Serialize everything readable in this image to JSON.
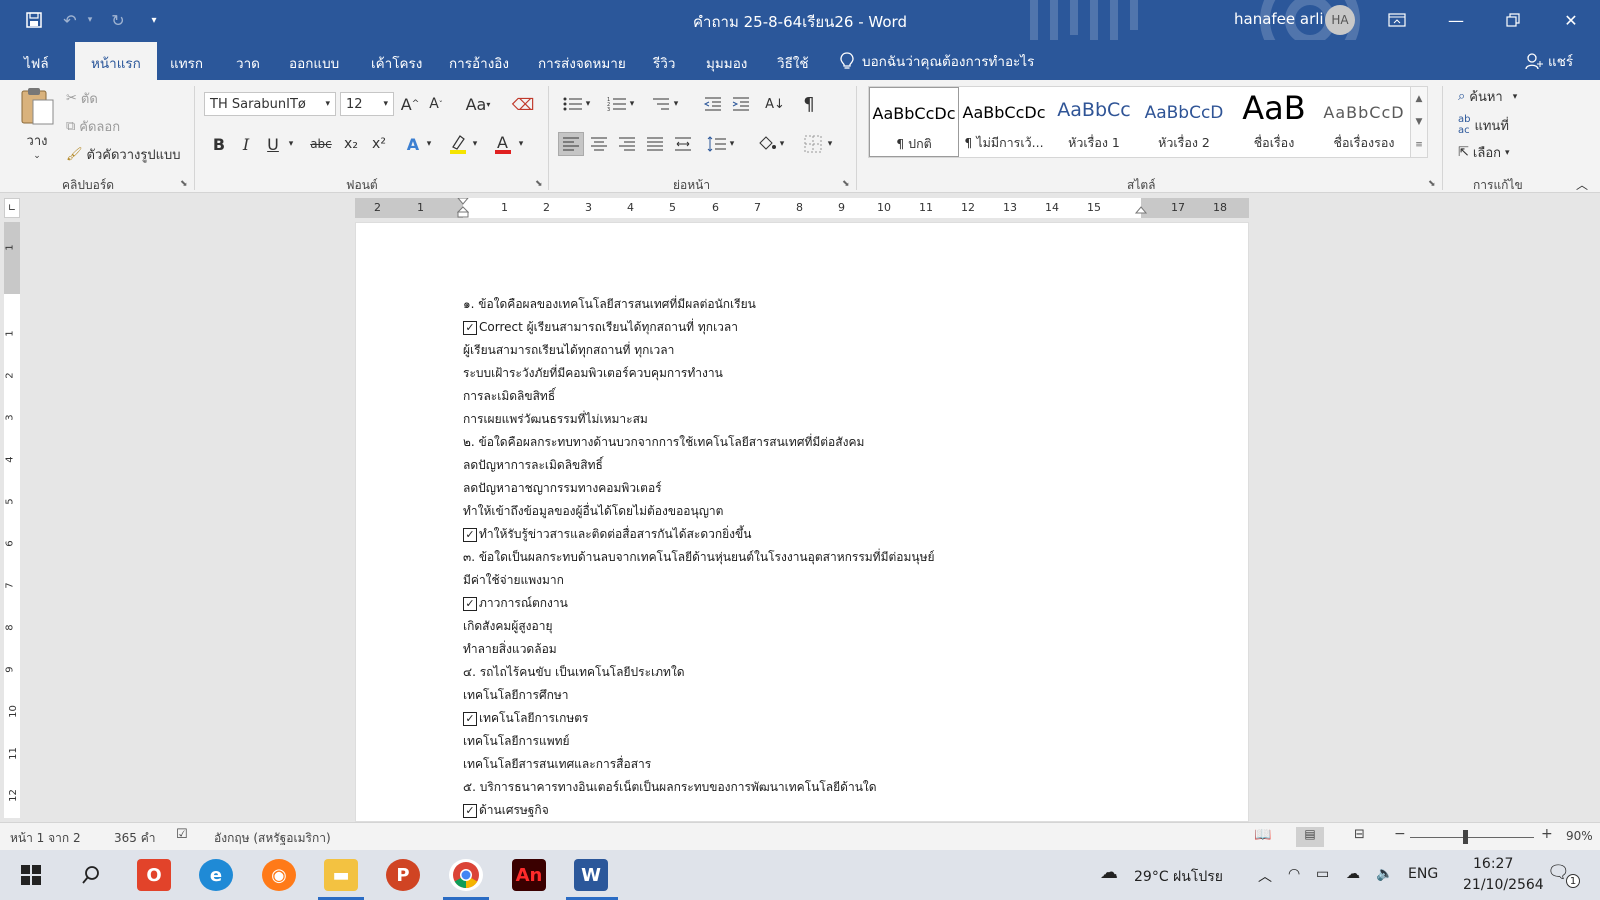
{
  "window": {
    "title": "คำถาม 25-8-64เรียน26  -  Word",
    "user_name": "hanafee arli",
    "user_initials": "HA"
  },
  "tabs": [
    "ไฟล์",
    "หน้าแรก",
    "แทรก",
    "วาด",
    "ออกแบบ",
    "เค้าโครง",
    "การอ้างอิง",
    "การส่งจดหมาย",
    "รีวิว",
    "มุมมอง",
    "วิธีใช้"
  ],
  "tell_me": "บอกฉันว่าคุณต้องการทำอะไร",
  "share": "แชร์",
  "clipboard": {
    "paste": "วาง",
    "cut": "ตัด",
    "copy": "คัดลอก",
    "format_painter": "ตัวคัดวางรูปแบบ",
    "label": "คลิปบอร์ด"
  },
  "font": {
    "name": "TH SarabunITø",
    "size": "12",
    "label": "ฟอนต์",
    "change_case": "Aa",
    "bold": "B",
    "italic": "I",
    "underline": "U",
    "strike": "abc",
    "subscript": "x₂",
    "superscript": "x²"
  },
  "paragraph": {
    "label": "ย่อหน้า"
  },
  "styles": {
    "label": "สไตล์",
    "items": [
      {
        "sample": "AaBbCcDc",
        "name": "¶ ปกติ"
      },
      {
        "sample": "AaBbCcDc",
        "name": "¶ ไม่มีการเว้..."
      },
      {
        "sample": "AaBbCc",
        "name": "หัวเรื่อง 1"
      },
      {
        "sample": "AaBbCcD",
        "name": "หัวเรื่อง 2"
      },
      {
        "sample": "AaB",
        "name": "ชื่อเรื่อง"
      },
      {
        "sample": "AaBbCcD",
        "name": "ชื่อเรื่องรอง"
      }
    ]
  },
  "editing": {
    "find": "ค้นหา",
    "replace": "แทนที่",
    "select": "เลือก",
    "label": "การแก้ไข"
  },
  "ruler": {
    "ticks": [
      "2",
      "1",
      "1",
      "2",
      "3",
      "4",
      "5",
      "6",
      "7",
      "8",
      "9",
      "10",
      "11",
      "12",
      "13",
      "14",
      "15",
      "17",
      "18"
    ],
    "vticks": [
      "1",
      "1",
      "2",
      "3",
      "4",
      "5",
      "6",
      "7",
      "8",
      "9",
      "10",
      "11",
      "12"
    ]
  },
  "document": {
    "lines": [
      {
        "text": "๑. ข้อใดคือผลของเทคโนโลยีสารสนเทศที่มีผลต่อนักเรียน",
        "checked": false
      },
      {
        "text": "Correct ผู้เรียนสามารถเรียนได้ทุกสถานที่ ทุกเวลา",
        "checked": true
      },
      {
        "text": "ผู้เรียนสามารถเรียนได้ทุกสถานที่ ทุกเวลา",
        "checked": false
      },
      {
        "text": "ระบบเฝ้าระวังภัยที่มีคอมพิวเตอร์ควบคุมการทำงาน",
        "checked": false
      },
      {
        "text": "การละเมิดลิขสิทธิ์",
        "checked": false
      },
      {
        "text": "การเผยแพร่วัฒนธรรมที่ไม่เหมาะสม",
        "checked": false
      },
      {
        "text": "๒. ข้อใดคือผลกระทบทางด้านบวกจากการใช้เทคโนโลยีสารสนเทศที่มีต่อสังคม",
        "checked": false
      },
      {
        "text": "ลดปัญหาการละเมิดลิขสิทธิ์",
        "checked": false
      },
      {
        "text": "ลดปัญหาอาชญากรรมทางคอมพิวเตอร์",
        "checked": false
      },
      {
        "text": "ทำให้เข้าถึงข้อมูลของผู้อื่นได้โดยไม่ต้องขออนุญาต",
        "checked": false
      },
      {
        "text": "ทำให้รับรู้ข่าวสารและติดต่อสื่อสารกันได้สะดวกยิ่งขึ้น",
        "checked": true
      },
      {
        "text": "๓. ข้อใดเป็นผลกระทบด้านลบจากเทคโนโลยีด้านหุ่นยนต์ในโรงงานอุตสาหกรรมที่มีต่อมนุษย์",
        "checked": false
      },
      {
        "text": "มีค่าใช้จ่ายแพงมาก",
        "checked": false
      },
      {
        "text": "ภาวการณ์ตกงาน",
        "checked": true
      },
      {
        "text": "เกิดสังคมผู้สูงอายุ",
        "checked": false
      },
      {
        "text": "ทำลายสิ่งแวดล้อม",
        "checked": false
      },
      {
        "text": "๔. รถไถไร้คนขับ เป็นเทคโนโลยีประเภทใด",
        "checked": false
      },
      {
        "text": "เทคโนโลยีการศึกษา",
        "checked": false
      },
      {
        "text": "เทคโนโลยีการเกษตร",
        "checked": true
      },
      {
        "text": "เทคโนโลยีการแพทย์",
        "checked": false
      },
      {
        "text": "เทคโนโลยีสารสนเทศและการสื่อสาร",
        "checked": false
      },
      {
        "text": "๕. บริการธนาคารทางอินเตอร์เน็ตเป็นผลกระทบของการพัฒนาเทคโนโลยีด้านใด",
        "checked": false
      },
      {
        "text": "ด้านเศรษฐกิจ",
        "checked": true
      }
    ]
  },
  "status": {
    "page": "หน้า 1 จาก 2",
    "words": "365 คำ",
    "language": "อังกฤษ (สหรัฐอเมริกา)",
    "zoom": "90%"
  },
  "taskbar": {
    "weather": "29°C  ฝนโปรย",
    "lang": "ENG",
    "time": "16:27",
    "date": "21/10/2564",
    "notifications": "1"
  }
}
